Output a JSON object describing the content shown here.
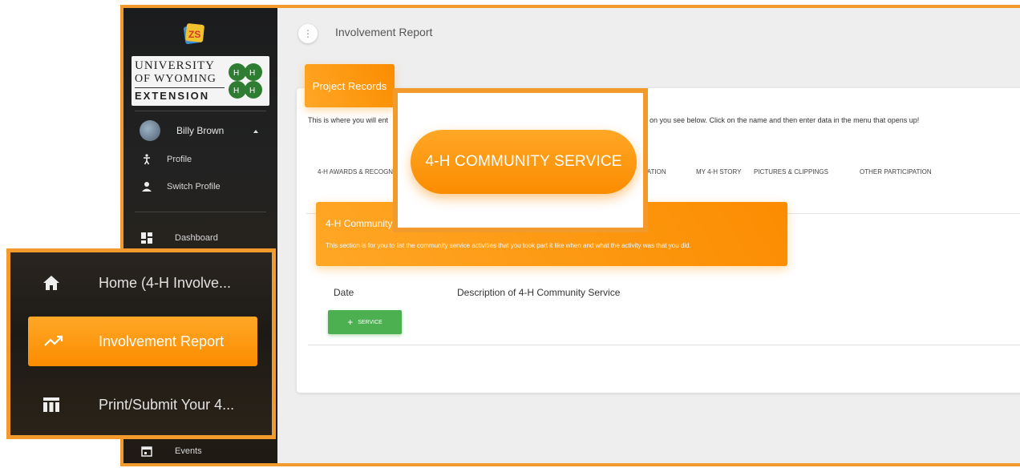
{
  "sidebar": {
    "logo_lines": [
      "UNIVERSITY",
      "OF WYOMING",
      "EXTENSION"
    ],
    "user_name": "Billy Brown",
    "items": [
      {
        "label": "Profile",
        "icon": "person-walking-icon"
      },
      {
        "label": "Switch Profile",
        "icon": "person-icon"
      },
      {
        "label": "Dashboard",
        "icon": "dashboard-icon"
      },
      {
        "label": "Events",
        "icon": "calendar-icon"
      }
    ]
  },
  "topbar": {
    "title": "Involvement Report"
  },
  "card": {
    "header": "Project Records",
    "intro_left": "This is where you will ent",
    "intro_right": "on you see below. Click on the name and then enter data in the menu that opens up!",
    "tabs": [
      "4-H AWARDS & RECOGNI",
      "PATION",
      "MY 4-H STORY",
      "PICTURES & CLIPPINGS",
      "OTHER PARTICIPATION"
    ],
    "section": {
      "title": "4-H Community",
      "description": "This section is for you to list the community service activities that you took part it like when and what the activity was that you did."
    },
    "columns": [
      "Date",
      "Description of 4-H Community Service"
    ],
    "add_button": "SERVICE"
  },
  "zoom_tab": {
    "label": "4-H COMMUNITY SERVICE"
  },
  "zoom_menu": {
    "items": [
      {
        "label": "Home (4-H Involve...",
        "icon": "home-icon",
        "active": false
      },
      {
        "label": "Involvement Report",
        "icon": "trending-icon",
        "active": true
      },
      {
        "label": "Print/Submit Your 4...",
        "icon": "table-icon",
        "active": false
      }
    ]
  },
  "colors": {
    "accent": "#fb8c00",
    "border": "#f39a2c",
    "success": "#4caf50"
  }
}
